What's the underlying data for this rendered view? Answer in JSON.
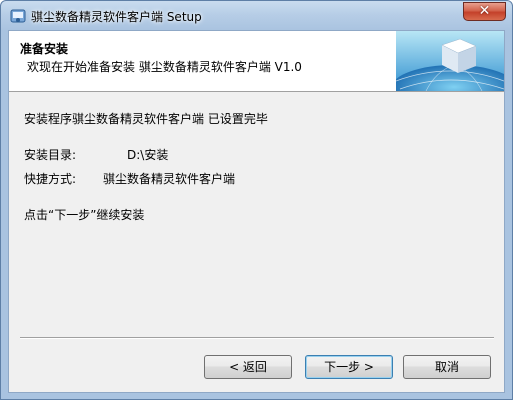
{
  "window": {
    "title": "骐尘数备精灵软件客户端 Setup"
  },
  "header": {
    "title": "准备安装",
    "subtitle": "欢现在开始准备安装 骐尘数备精灵软件客户端 V1.0"
  },
  "body": {
    "ready_message": "安装程序骐尘数备精灵软件客户端 已设置完毕",
    "install_dir_label": "安装目录:",
    "install_dir_value": "D:\\安装",
    "shortcut_label": "快捷方式:",
    "shortcut_value": "骐尘数备精灵软件客户端",
    "continue_hint": "点击“下一步”继续安装"
  },
  "buttons": {
    "back": "< 返回",
    "next": "下一步 >",
    "cancel": "取消"
  },
  "colors": {
    "accent": "#3c7fb1",
    "close": "#c4412a"
  }
}
